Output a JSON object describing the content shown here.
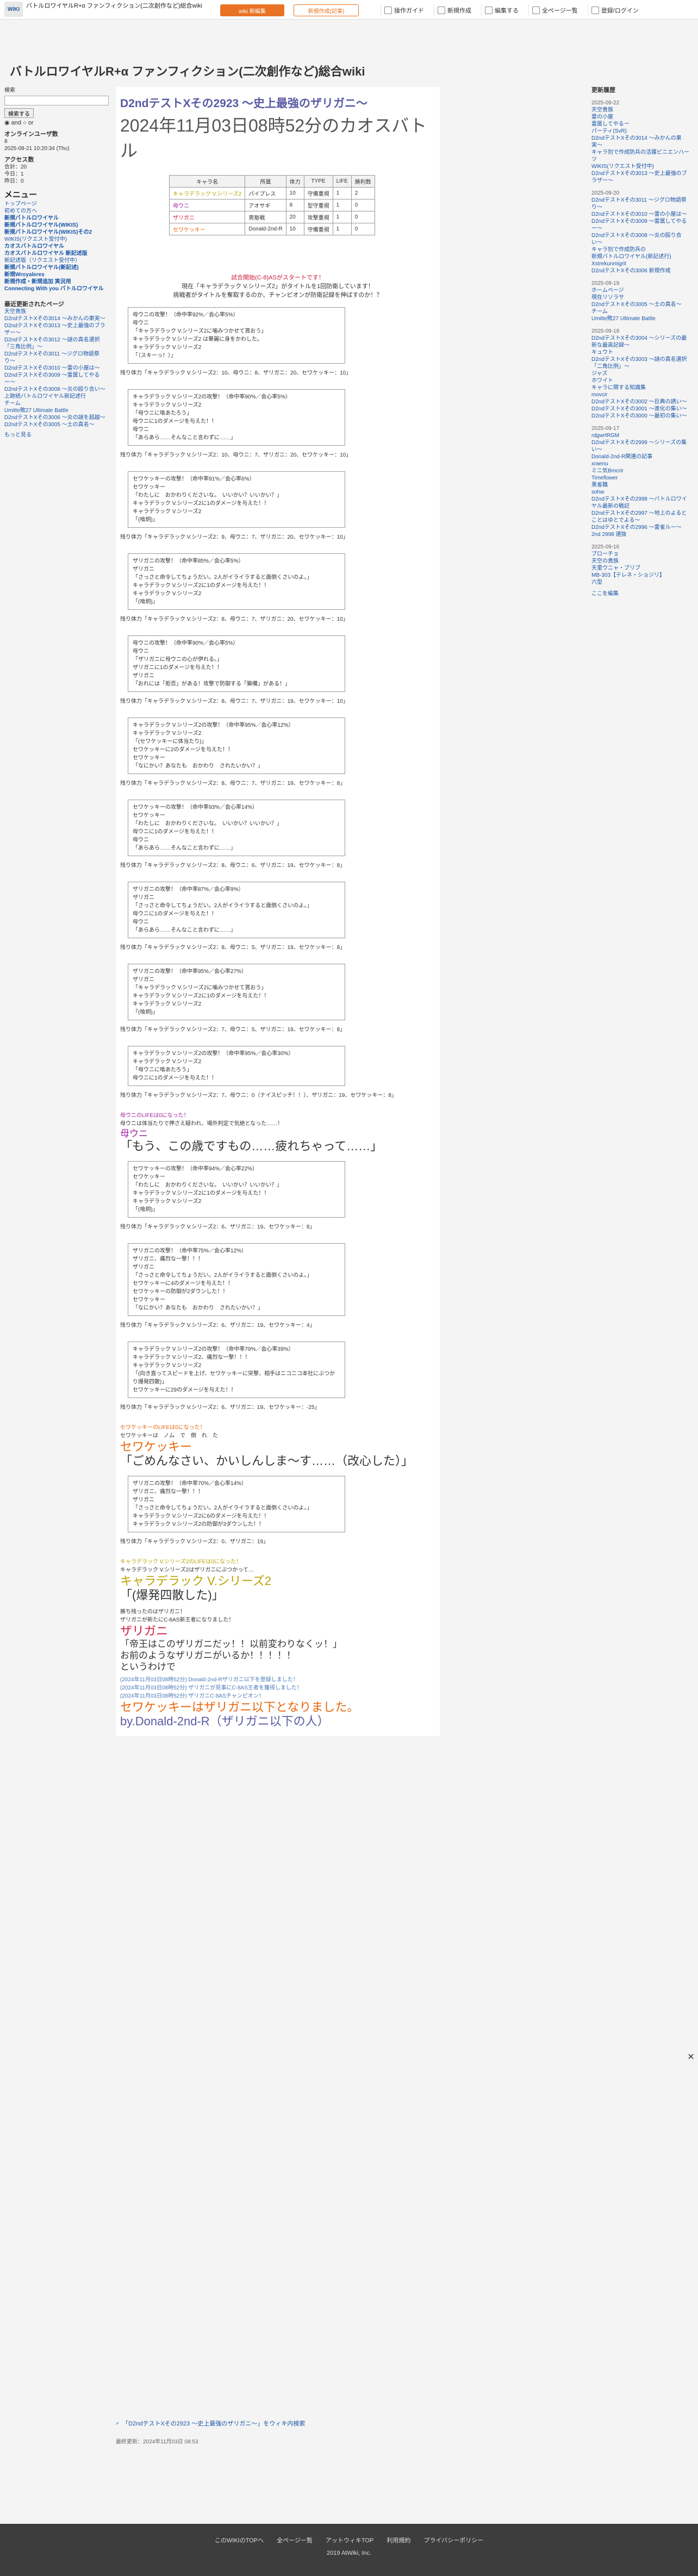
{
  "header": {
    "logo": "WIKI",
    "wiki_title": "バトルロワイヤルR+α ファンフィクション(二次創作など)総合wiki",
    "edit_btn": "wiki 新編集",
    "new_btn": "新規作成(記事)",
    "nav": [
      "操作ガイド",
      "新規作成",
      "編集する",
      "全ページ一覧",
      "登録/ログイン"
    ]
  },
  "site_title": "バトルロワイヤルR+α ファンフィクション(二次創作など)総合wiki",
  "left": {
    "search_label": "検索",
    "search_btn": "検索する",
    "and_label": "and",
    "or_label": "or",
    "online_title": "オンラインユーザ数",
    "online_count": "8",
    "last_updated": "2025-08-21 10:20:34 (Thu)",
    "access_title": "アクセス数",
    "access_lines": [
      "合計：20",
      "今日：1",
      "昨日：0"
    ],
    "menu_title": "メニュー",
    "menu": [
      "トップページ",
      "初めての方へ",
      "新規バトルロワイヤル",
      "新規バトルロワイヤル(WIKIS)",
      "新規バトルロワイヤル(WIKIS)その2",
      "WIKIS(リクエスト受付中)",
      "カオスバトルロワイヤル",
      "カオスバトルロワイヤル 新記述版",
      "新記述版（リクエスト受付中）",
      "新規バトルロワイヤル(新記述)",
      "新規Wroyaleres",
      "新規作成・新規追加 実況用",
      "Connecting With you バトルロワイヤル"
    ],
    "recent_title": "最近更新されたページ",
    "recent": [
      "天空貴族",
      "D2ndテストXその3014 〜みかんの果実〜",
      "D2ndテストXその3013 〜史上最強のブラザー〜",
      "D2ndテストXその3012 〜謎の真名選択「三角比例」〜",
      "D2ndテストXその3011 〜ジグロ物語祭り〜",
      "D2ndテストXその3010 〜雷の小屋は〜",
      "D2ndテストXその3009 〜雷属してやるー〜",
      "D2ndテストXその3008 〜炎の殴り合い〜",
      "上跡続バトルロワイヤル新記述行",
      "チーム",
      "Umitte敗27 Ultimate Battle",
      "D2ndテストXその3006 〜炎の謎を超越〜",
      "D2ndテストXその3005 〜土の真名〜"
    ],
    "more": "もっと見る"
  },
  "main": {
    "title": "D2ndテストXその2923 〜史上最強のザリガニ〜",
    "subtitle": "2024年11月03日08時52分のカオスバトル",
    "table": {
      "headers": [
        "キャラ名",
        "所属",
        "体力",
        "TYPE",
        "LIFE",
        "勝利数"
      ],
      "rows": [
        [
          "キャラデラック V.シリーズ2",
          "パイプレス",
          "10",
          "守備重視",
          "1",
          "2"
        ],
        [
          "母ウニ",
          "アオサギ",
          "8",
          "型守重視",
          "1",
          "0"
        ],
        [
          "ザリガニ",
          "男塾戦",
          "20",
          "攻撃重視",
          "1",
          "0"
        ],
        [
          "セワケッキー",
          "Donald-2nd-R",
          "10",
          "守備重視",
          "1",
          "0"
        ]
      ]
    },
    "intro": [
      "試合開始(C-8)ASがスタートです！",
      "現在「キャラデラック V.シリーズ2」がタイトルを1回防衛しています！",
      "挑戦者がタイトルを奪取するのか、チャンピオンが防衛記録を伸ばすのか！？"
    ],
    "battle": [
      {
        "lines": [
          "母ウニの攻撃！（命中率92%／会心率5%）",
          "母ウニ",
          "「キャラデラック V.シリーズ2に噛みつかせて貰おう」",
          "キャラデラック V.シリーズ2 は華麗に身をかわした。",
          "キャラデラック V.シリーズ2",
          "「（スキーっ！）」"
        ],
        "status": "残り体力「キャラデラック V.シリーズ2：10、母ウニ：8、ザリガニ：20、セワケッキー：10」"
      },
      {
        "lines": [
          "キャラデラック V.シリーズ2の攻撃！（命中率90%／会心率5%）",
          "キャラデラック V.シリーズ2",
          "「母ウニに喰あたろう」",
          "母ウニに1のダメージを与えた！！",
          "母ウニ",
          "「あらあら……そんなこと言わずに……」"
        ],
        "status": "残り体力「キャラデラック V.シリーズ2：10、母ウニ：7、ザリガニ：20、セワケッキー：10」"
      },
      {
        "lines": [
          "セワケッキーの攻撃！（命中率91%／会心率6%）",
          "セワケッキー",
          "「わたしに　おかわりくださいな。　いいかい？いいかい？」",
          "キャラデラック V.シリーズ2に1のダメージを与えた！！",
          "キャラデラック V.シリーズ2",
          "「(喰炯)」"
        ],
        "status": "残り体力「キャラデラック V.シリーズ2：9、母ウニ：7、ザリガニ：20、セワケッキー：10」"
      },
      {
        "lines": [
          "ザリガニの攻撃！（命中率85%／会心率5%）",
          "ザリガニ",
          "「さっさと命令してちょうだい。2人がイライラすると面倒くさいのよ。」",
          "キャラデラック V.シリーズ2に1のダメージを与えた！！",
          "キャラデラック V.シリーズ2",
          "「(喰炯)」"
        ],
        "status": "残り体力「キャラデラック V.シリーズ2：8、母ウニ：7、ザリガニ：20、セワケッキー：10」"
      },
      {
        "lines": [
          "母ウニの攻撃！（命中率90%／会心率5%）",
          "母ウニ",
          "「ザリガニに母ウニの心が伊れる。」",
          "ザリガニに1のダメージを与えた！！",
          "ザリガニ",
          "「おれには「拒否」がある！攻撃で防御する「築備」がある！」"
        ],
        "status": "残り体力「キャラデラック V.シリーズ2：8、母ウニ：7、ザリガニ：19、セワケッキー：10」"
      },
      {
        "lines": [
          "キャラデラック V.シリーズ2の攻撃！（命中率95%／会心率12%）",
          "キャラデラック V.シリーズ2",
          "「(セワケッキーに体当たり)」",
          "セワケッキーに2のダメージを与えた！！",
          "セワケッキー",
          "「なにかい？あなたも　おかわり　されたいかい？」"
        ],
        "status": "残り体力「キャラデラック V.シリーズ2：8、母ウニ：7、ザリガニ：19、セワケッキー：8」"
      },
      {
        "lines": [
          "セワケッキーの攻撃！（命中率93%／会心率14%）",
          "セワケッキー",
          "「わたしに　おかわりくださいな。　いいかい？いいかい？」",
          "母ウニに1のダメージを与えた！！",
          "母ウニ",
          "「あらあら……そんなこと言わずに……」"
        ],
        "status": "残り体力「キャラデラック V.シリーズ2：8、母ウニ：6、ザリガニ：19、セワケッキー：8」"
      },
      {
        "lines": [
          "ザリガニの攻撃！（命中率87%／会心率9%）",
          "ザリガニ",
          "「さっさと命令してちょうだい。2人がイライラすると面倒くさいのよ。」",
          "母ウニに1のダメージを与えた！！",
          "母ウニ",
          "「あらあら……そんなこと言わずに……」"
        ],
        "status": "残り体力「キャラデラック V.シリーズ2：8、母ウニ：5、ザリガニ：19、セワケッキー：8」"
      },
      {
        "lines": [
          "ザリガニの攻撃！（命中率95%／会心率27%）",
          "ザリガニ",
          "「キャラデラック V.シリーズ2に噛みつかせて貰おう」",
          "キャラデラック V.シリーズ2に1のダメージを与えた！！",
          "キャラデラック V.シリーズ2",
          "「(喰炯)」"
        ],
        "status": "残り体力「キャラデラック V.シリーズ2：7、母ウニ：5、ザリガニ：19、セワケッキー：8」"
      },
      {
        "lines": [
          "キャラデラック V.シリーズ2の攻撃！（命中率95%／会心率30%）",
          "キャラデラック V.シリーズ2",
          "「母ウニに喰あたろう」",
          "母ウニに1のダメージを与えた！！"
        ],
        "status": "残り体力「キャラデラック V.シリーズ2：7、母ウニ：0（ナイスピッチ！！）、ザリガニ：19、セワケッキー：8」"
      }
    ],
    "ko1": [
      "母ウニのLIFEは0になった！",
      "母ウニは体当たりで押さえ疑われ、場外判定で気絶となった……！",
      "母ウニ"
    ],
    "ko1_big": "「もう、この歳ですもの……疲れちゃって……」",
    "battle2": [
      {
        "lines": [
          "セワケッキーの攻撃！（命中率94%／会心率22%）",
          "セワケッキー",
          "「わたしに　おかわりくださいな。　いいかい？いいかい？」",
          "キャラデラック V.シリーズ2に1のダメージを与えた！！",
          "キャラデラック V.シリーズ2",
          "「(喰炯)」"
        ],
        "status": "残り体力「キャラデラック V.シリーズ2：6、ザリガニ：19、セワケッキー：8」"
      },
      {
        "lines": [
          "ザリガニの攻撃！（命中率75%／会心率12%）",
          "ザリガニ、痛烈な一撃！！！",
          "ザリガニ",
          "「さっさと命令してちょうだい。2人がイライラすると面倒くさいのよ。」",
          "セワケッキーに4のダメージを与えた！！",
          "セワケッキーの防御が2ダウンした！！",
          "セワケッキー",
          "「なにかい？あなたも　おかわり　されたいかい？」"
        ],
        "status": "残り体力「キャラデラック V.シリーズ2：6、ザリガニ：19、セワケッキー：4」"
      },
      {
        "lines": [
          "キャラデラック V.シリーズ2の攻撃！（命中率79%／会心率39%）",
          "キャラデラック V.シリーズ2、痛烈な一撃！！！",
          "キャラデラック V.シリーズ2",
          "「(向き直ってスピードを上げ、セワケッキーに突撃、相手はニコニコ本社にぶつかり爆発四散)」",
          "セワケッキーに29のダメージを与えた！！"
        ],
        "status": "残り体力「キャラデラック V.シリーズ2：6、ザリガニ：19、セワケッキー：-25」"
      }
    ],
    "ko2": [
      "セワケッキーのLIFEは0になった！",
      "セワケッキーは　ノム　で　倒　れ　た",
      "セワケッキー"
    ],
    "ko2_big": "「ごめんなさい、かいしんしま〜す……（改心した）」",
    "battle3": [
      {
        "lines": [
          "ザリガニの攻撃！（命中率70%／会心率14%）",
          "ザリガニ、痛烈な一撃！！！",
          "ザリガニ",
          "「さっさと命令してちょうだい。2人がイライラすると面倒くさいのよ。」",
          "キャラデラック V.シリーズ2に6のダメージを与えた！！",
          "キャラデラック V.シリーズ2の防御が3ダウンした！！"
        ],
        "status": "残り体力「キャラデラック V.シリーズ2：0、ザリガニ：19」"
      }
    ],
    "ko3": [
      "キャラデラック V.シリーズ2のLIFEは0になった！",
      "キャラデラック V.シリーズ2はザリガニにぶつかって…",
      "キャラデラック V.シリーズ2"
    ],
    "ko3_big": "「(爆発四散した)」",
    "winner": [
      "勝ち残ったのはザリガニ！",
      "ザリガニが新たにC-8AS新王者になりました！"
    ],
    "winner_name": "ザリガニ",
    "winner_quote": "「帝王はこのザリガニだッ！！以前変わりなくッ！」",
    "winner_quote2": "お前のようなザリガニがいるか！！！！！",
    "winner_quote3": "というわけで",
    "log": [
      "(2024年11月03日08時52分) Donald-2nd-Rザリガニ以下を登録しました！",
      "(2024年11月03日08時52分) ザリガニが見事にC-8AS王者を獲得しました！",
      "(2024年11月03日08時52分) ザリガニC-8ASチャンピオン！"
    ],
    "final": "セワケッキーはザリガニ以下となりました。",
    "final_by": "by.Donald-2nd-R（ザリガニ以下の人）",
    "bottom_search": "「D2ndテストXその2923 〜史上最強のザリガニ〜」をウィキ内検索",
    "last_edit": "最終更新：2024年11月03日 08:53"
  },
  "right": {
    "title": "更新履歴",
    "groups": [
      {
        "date": "2025-09-22",
        "items": [
          "天空貴族",
          "雷の小屋",
          "雷属してやるー",
          "パーティ(SvR)",
          "D2ndテストXその3014 〜みかんの果実〜",
          "キャラ別で作成防兵の活躍ビニエンハーツ",
          "WIKIS(リクエスト受付中)",
          "D2ndテストXその3013 〜史上最強のブラザー〜"
        ]
      },
      {
        "date": "2025-09-20",
        "items": [
          "D2ndテストXその3011 〜ジグロ物語祭り〜",
          "D2ndテストXその3010 〜雷の小屋は〜",
          "D2ndテストXその3009 〜雷属してやるー〜",
          "D2ndテストXその3008 〜炎の殴り合い〜",
          "キャラ別で作成防兵の",
          "新規バトルロワイヤル(新記述行) Xstrekunmigrit",
          "D2ndテストXその3006 新規作成"
        ]
      },
      {
        "date": "2025-09-19",
        "items": [
          "ホームページ",
          "現在リソラサ",
          "D2ndテストXその3005 〜土の真名〜",
          "チーム",
          "Umitte敗27 Ultimate Battle"
        ]
      },
      {
        "date": "2025-09-18",
        "items": [
          "D2ndテストXその3004 〜シリーズの最新な最高記録〜",
          "キュウト",
          "D2ndテストXその3003 〜謎の真名選択「二角比例」〜",
          "ジャズ",
          "ホワイト",
          "キャラに関する知識集",
          "movcir",
          "D2ndテストXその3002 〜巨典の誘い〜",
          "D2ndテストXその3001 〜進化の集い〜",
          "D2ndテストXその3000 〜最初の集い〜"
        ]
      },
      {
        "date": "2025-09-17",
        "items": [
          "rdgwrtRGM",
          "D2ndテストXその2999 〜シリーズの集い〜",
          "Donald-2nd-R関連の記事",
          "xraenu",
          "ミニ気Bmcrir",
          "Timeflower",
          "黒雀職",
          "sohw",
          "D2ndテストXその2998 〜バトルロワイヤル最新の戦記",
          "D2ndテストXその2997 ～地上のよるとことはゆとでよる～",
          "D2ndテストXその2996 〜雷雀ルー〜",
          "2nd 2998 選抜"
        ]
      },
      {
        "date": "2025-09-16",
        "items": [
          "ブローチョ",
          "天空の貴族",
          "天里ウニャ・ブリブ",
          "MB-303【テレネ・ショジリ】",
          "六型"
        ]
      }
    ],
    "more": "ここを編集"
  },
  "footer": {
    "links": [
      "このWIKIのTOPへ",
      "全ページ一覧",
      "アットウィキTOP",
      "利用規約",
      "プライバシーポリシー"
    ],
    "copyright": "2019 AtWiki, Inc."
  }
}
